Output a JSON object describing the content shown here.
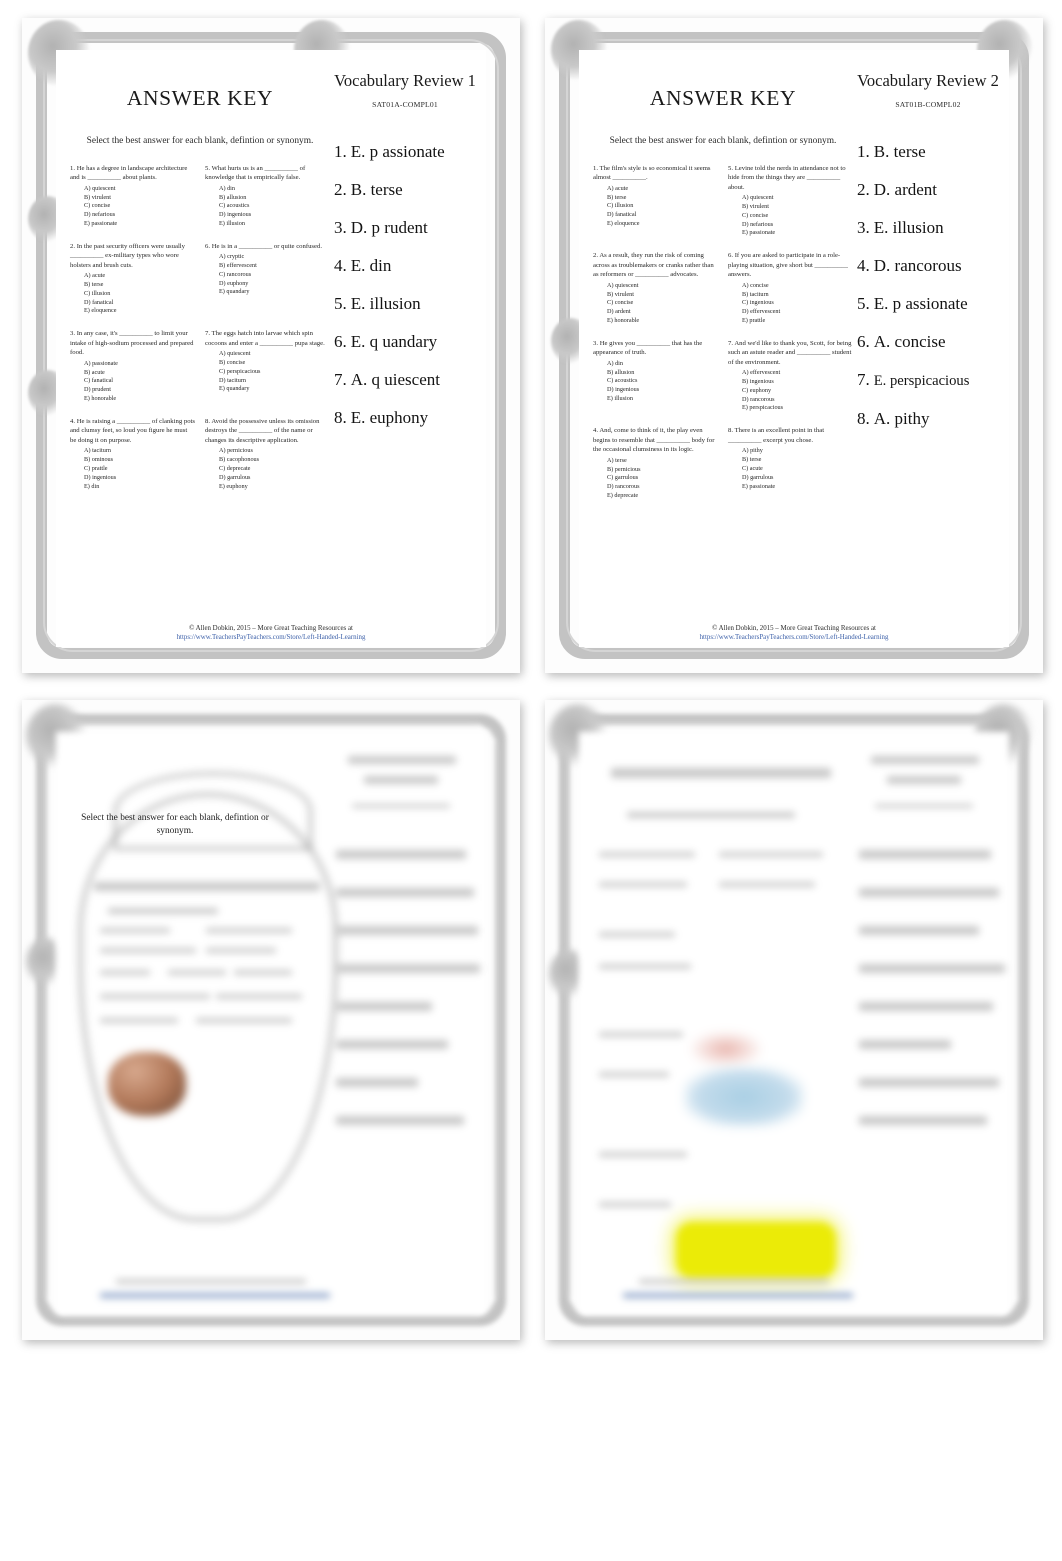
{
  "document": {
    "view": "two-page-thumbnail-spread",
    "shared": {
      "answer_key_title": "ANSWER KEY",
      "instructions": "Select the best answer for each blank, defintion or synonym.",
      "footer_copyright": "© Allen Dobkin, 2015   –  More Great Teaching Resources at",
      "footer_link": "https://www.TeachersPayTeachers.com/Store/Left-Handed-Learning",
      "link_color": "#3b5fa8"
    }
  },
  "page1": {
    "answer_key_title": "ANSWER KEY",
    "instructions": "Select the best answer for each blank, defintion or synonym.",
    "side_title": "Vocabulary Review 1",
    "side_code": "SAT01A-COMPL01",
    "questions": [
      {
        "number": "1.",
        "stem": "1. He has a degree in landscape architecture and is __________ about plants.",
        "choices": [
          "A) quiescent",
          "B) virulent",
          "C) concise",
          "D) nefarious",
          "E) passionate"
        ]
      },
      {
        "number": "5.",
        "stem": "5.  What hurts us is an __________ of knowledge that is empirically false.",
        "choices": [
          "A) din",
          "B) allusion",
          "C) acoustics",
          "D) ingenious",
          "E) illusion"
        ]
      },
      {
        "number": "2.",
        "stem": "2. In the past security officers were usually __________ ex-military types who wore holsters and brush cuts.",
        "choices": [
          "A) acute",
          "B) terse",
          "C) illusion",
          "D) fanatical",
          "E) eloquence"
        ]
      },
      {
        "number": "6.",
        "stem": "6. He is in a __________ or quite confused.",
        "choices": [
          "A) cryptic",
          "B) effervescent",
          "C) rancorous",
          "D) euphony",
          "E) quandary"
        ]
      },
      {
        "number": "3.",
        "stem": "3.  In any case, it's __________ to limit your intake of high-sodium processed and prepared food.",
        "choices": [
          "A) passionate",
          "B) acute",
          "C) fanatical",
          "D) prudent",
          "E) honorable"
        ]
      },
      {
        "number": "7.",
        "stem": "7. The eggs hatch into larvae which spin cocoons and enter a __________ pupa stage.",
        "choices": [
          "A) quiescent",
          "B) concise",
          "C) perspicacious",
          "D) taciturn",
          "E) quandary"
        ]
      },
      {
        "number": "4.",
        "stem": "4. He is raising a __________ of clanking pots and clumsy feet, so loud you figure he must be doing it on purpose.",
        "choices": [
          "A) taciturn",
          "B) ominous",
          "C) prattle",
          "D) ingenious",
          "E) din"
        ]
      },
      {
        "number": "8.",
        "stem": "8. Avoid the possessive unless its omission destroys the __________ of the name or changes its descriptive application.",
        "choices": [
          "A) pernicious",
          "B) cacophonous",
          "C) deprecate",
          "D) garrulous",
          "E) euphony"
        ]
      }
    ],
    "answers": [
      {
        "num": "1.",
        "text": "E. p assionate"
      },
      {
        "num": "2.",
        "text": "B. terse"
      },
      {
        "num": "3.",
        "text": "D. p rudent"
      },
      {
        "num": "4.",
        "text": "E. din"
      },
      {
        "num": "5.",
        "text": "E. illusion"
      },
      {
        "num": "6.",
        "text": "E. q uandary"
      },
      {
        "num": "7.",
        "text": "A. q uiescent"
      },
      {
        "num": "8.",
        "text": "E. euphony"
      }
    ],
    "footer_copyright": "© Allen Dobkin, 2015   –  More Great Teaching Resources at",
    "footer_link": "https://www.TeachersPayTeachers.com/Store/Left-Handed-Learning"
  },
  "page2": {
    "answer_key_title": "ANSWER KEY",
    "instructions": "Select the best answer for each blank, defintion or synonym.",
    "side_title": "Vocabulary Review 2",
    "side_code": "SAT01B-COMPL02",
    "questions": [
      {
        "number": "1.",
        "stem": "1. The film's style is so economical it seems almost __________.",
        "choices": [
          "A) acute",
          "B) terse",
          "C) illusion",
          "D) fanatical",
          "E) eloquence"
        ]
      },
      {
        "number": "5.",
        "stem": "5.  Levine told the nerds in attendance not to hide from the things they are __________ about.",
        "choices": [
          "A) quiescent",
          "B) virulent",
          "C) concise",
          "D) nefarious",
          "E) passionate"
        ]
      },
      {
        "number": "2.",
        "stem": "2. As a result, they run the risk of coming across as troublemakers or cranks rather than as reformers or __________ advocates.",
        "choices": [
          "A) quiescent",
          "B) virulent",
          "C) concise",
          "D) ardent",
          "E) honorable"
        ]
      },
      {
        "number": "6.",
        "stem": "6. If you are asked to participate in a role-playing situation, give short but __________ answers.",
        "choices": [
          "A) concise",
          "B) taciturn",
          "C) ingenious",
          "D) effervescent",
          "E) prattle"
        ]
      },
      {
        "number": "3.",
        "stem": "3.  He gives you __________ that has the appearance of truth.",
        "choices": [
          "A) din",
          "B) allusion",
          "C) acoustics",
          "D) ingenious",
          "E) illusion"
        ]
      },
      {
        "number": "7.",
        "stem": "7. And we'd like to thank you, Scott, for being such an astute reader and __________ student of the environment.",
        "choices": [
          "A) effervescent",
          "B) ingenious",
          "C) euphony",
          "D) rancorous",
          "E) perspicacious"
        ]
      },
      {
        "number": "4.",
        "stem": "4.  And, come to think of it, the play even begins to resemble that __________ body for the occasional clumsiness in its logic.",
        "choices": [
          "A) terse",
          "B) pernicious",
          "C) garrulous",
          "D) rancorous",
          "E) deprecate"
        ]
      },
      {
        "number": "8.",
        "stem": "8. There is an excellent point in that __________ excerpt you chose.",
        "choices": [
          "A) pithy",
          "B) terse",
          "C) acute",
          "D) garrulous",
          "E) passionate"
        ]
      }
    ],
    "answers": [
      {
        "num": "1.",
        "text": "B. terse"
      },
      {
        "num": "2.",
        "text": "D. ardent"
      },
      {
        "num": "3.",
        "text": "E. illusion"
      },
      {
        "num": "4.",
        "text": "D. rancorous"
      },
      {
        "num": "5.",
        "text": "E. p assionate"
      },
      {
        "num": "6.",
        "text": "A. concise"
      },
      {
        "num": "7.",
        "text": "E. perspicacious"
      },
      {
        "num": "8.",
        "text": "A. pithy"
      }
    ],
    "footer_copyright": "© Allen Dobkin, 2015   –  More Great Teaching Resources at",
    "footer_link": "https://www.TeachersPayTeachers.com/Store/Left-Handed-Learning"
  },
  "page3": {
    "instructions": "Select the best answer for each blank, defintion or synonym."
  },
  "page4": {
    "instructions": ""
  }
}
